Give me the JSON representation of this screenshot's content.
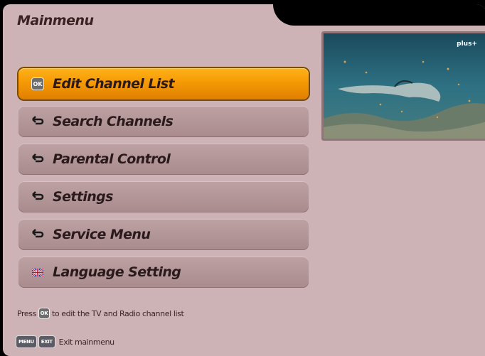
{
  "header": {
    "title": "Mainmenu"
  },
  "menu": {
    "items": [
      {
        "label": "Edit Channel List",
        "icon": "ok-button-icon",
        "selected": true
      },
      {
        "label": "Search Channels",
        "icon": "arrow-return-icon",
        "selected": false
      },
      {
        "label": "Parental Control",
        "icon": "arrow-return-icon",
        "selected": false
      },
      {
        "label": "Settings",
        "icon": "arrow-return-icon",
        "selected": false
      },
      {
        "label": "Service Menu",
        "icon": "arrow-return-icon",
        "selected": false
      },
      {
        "label": "Language Setting",
        "icon": "uk-flag-icon",
        "selected": false
      }
    ]
  },
  "preview": {
    "channel_logo": "plus+"
  },
  "hint": {
    "prefix": "Press",
    "ok": "OK",
    "suffix": "to edit the TV and Radio channel list"
  },
  "footer": {
    "menu_key": "MENU",
    "exit_key": "EXIT",
    "label": "Exit mainmenu"
  },
  "colors": {
    "panel": "#cdb3b5",
    "selected": "#f59a05",
    "item": "#b39597"
  }
}
